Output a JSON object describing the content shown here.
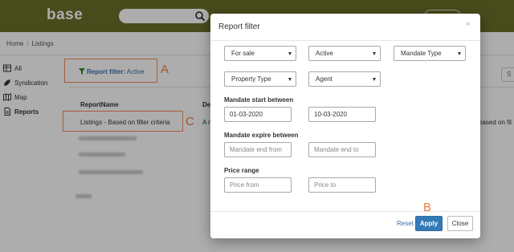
{
  "app": {
    "logo": "base"
  },
  "breadcrumb": {
    "home": "Home",
    "current": "Listings",
    "separator": "/"
  },
  "sidebar": {
    "items": [
      {
        "label": "All",
        "icon": "list-icon"
      },
      {
        "label": "Syndication",
        "icon": "rocket-icon"
      },
      {
        "label": "Map",
        "icon": "map-icon"
      },
      {
        "label": "Reports",
        "icon": "document-icon"
      }
    ]
  },
  "filter_bar": {
    "prefix": "Report filter:",
    "status": "Active",
    "right_button": "S"
  },
  "table": {
    "headers": {
      "report_name": "ReportName",
      "description": "De"
    },
    "row1": {
      "name": "Listings - Based on filter criteria",
      "desc_left": "A r",
      "desc_right": "based on fil"
    }
  },
  "annotations": {
    "a": "A",
    "b": "B",
    "c": "C"
  },
  "modal": {
    "title": "Report filter",
    "close_glyph": "×",
    "selects": {
      "listing_type": "For sale",
      "status": "Active",
      "mandate_type": "Mandate Type",
      "property_type": "Property Type",
      "agent": "Agent"
    },
    "mandate_start": {
      "label": "Mandate start between",
      "from": "01-03-2020",
      "to": "10-03-2020"
    },
    "mandate_expire": {
      "label": "Mandate expire between",
      "from_placeholder": "Mandate end from",
      "to_placeholder": "Mandate end to"
    },
    "price_range": {
      "label": "Price range",
      "from_placeholder": "Price from",
      "to_placeholder": "Price to"
    },
    "footer": {
      "reset": "Reset",
      "apply": "Apply",
      "close": "Close"
    }
  },
  "colors": {
    "topbar": "#6b6f28",
    "link": "#3a6fa8",
    "primary_button": "#337ab7",
    "annotation": "#f07a3c"
  }
}
